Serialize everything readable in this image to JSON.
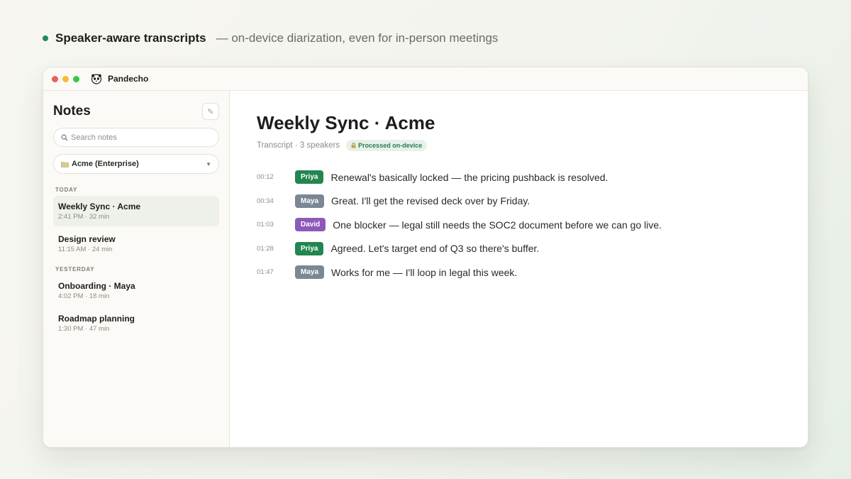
{
  "headline": {
    "strong": "Speaker-aware transcripts",
    "sub": "— on-device diarization, even for in-person meetings"
  },
  "app": {
    "name": "Pandecho"
  },
  "sidebar": {
    "title": "Notes",
    "search_placeholder": "Search notes",
    "workspace": "Acme (Enterprise)",
    "sections": [
      {
        "label": "TODAY",
        "notes": [
          {
            "title": "Weekly Sync · Acme",
            "meta": "2:41 PM · 32 min"
          },
          {
            "title": "Design review",
            "meta": "11:15 AM · 24 min"
          }
        ]
      },
      {
        "label": "YESTERDAY",
        "notes": [
          {
            "title": "Onboarding · Maya",
            "meta": "4:02 PM · 18 min"
          },
          {
            "title": "Roadmap planning",
            "meta": "1:30 PM · 47 min"
          }
        ]
      }
    ]
  },
  "main": {
    "title": "Weekly Sync · Acme",
    "meta": "Transcript · 3 speakers",
    "badge": "Processed on-device",
    "transcript": [
      {
        "time": "00:12",
        "speaker": "Priya",
        "text": "Renewal's basically locked — the pricing pushback is resolved."
      },
      {
        "time": "00:34",
        "speaker": "Maya",
        "text": "Great. I'll get the revised deck over by Friday."
      },
      {
        "time": "01:03",
        "speaker": "David",
        "text": "One blocker — legal still needs the SOC2 document before we can go live."
      },
      {
        "time": "01:28",
        "speaker": "Priya",
        "text": "Agreed. Let's target end of Q3 so there's buffer."
      },
      {
        "time": "01:47",
        "speaker": "Maya",
        "text": "Works for me — I'll loop in legal this week."
      }
    ]
  },
  "colors": {
    "accent": "#1f8a57",
    "speaker_priya": "#23864f",
    "speaker_maya": "#7b8794",
    "speaker_david": "#8b5ab8"
  },
  "icons": {
    "compose": "pencil-icon",
    "search": "magnifier-icon",
    "workspace": "folder-icon",
    "badge": "lock-icon"
  }
}
